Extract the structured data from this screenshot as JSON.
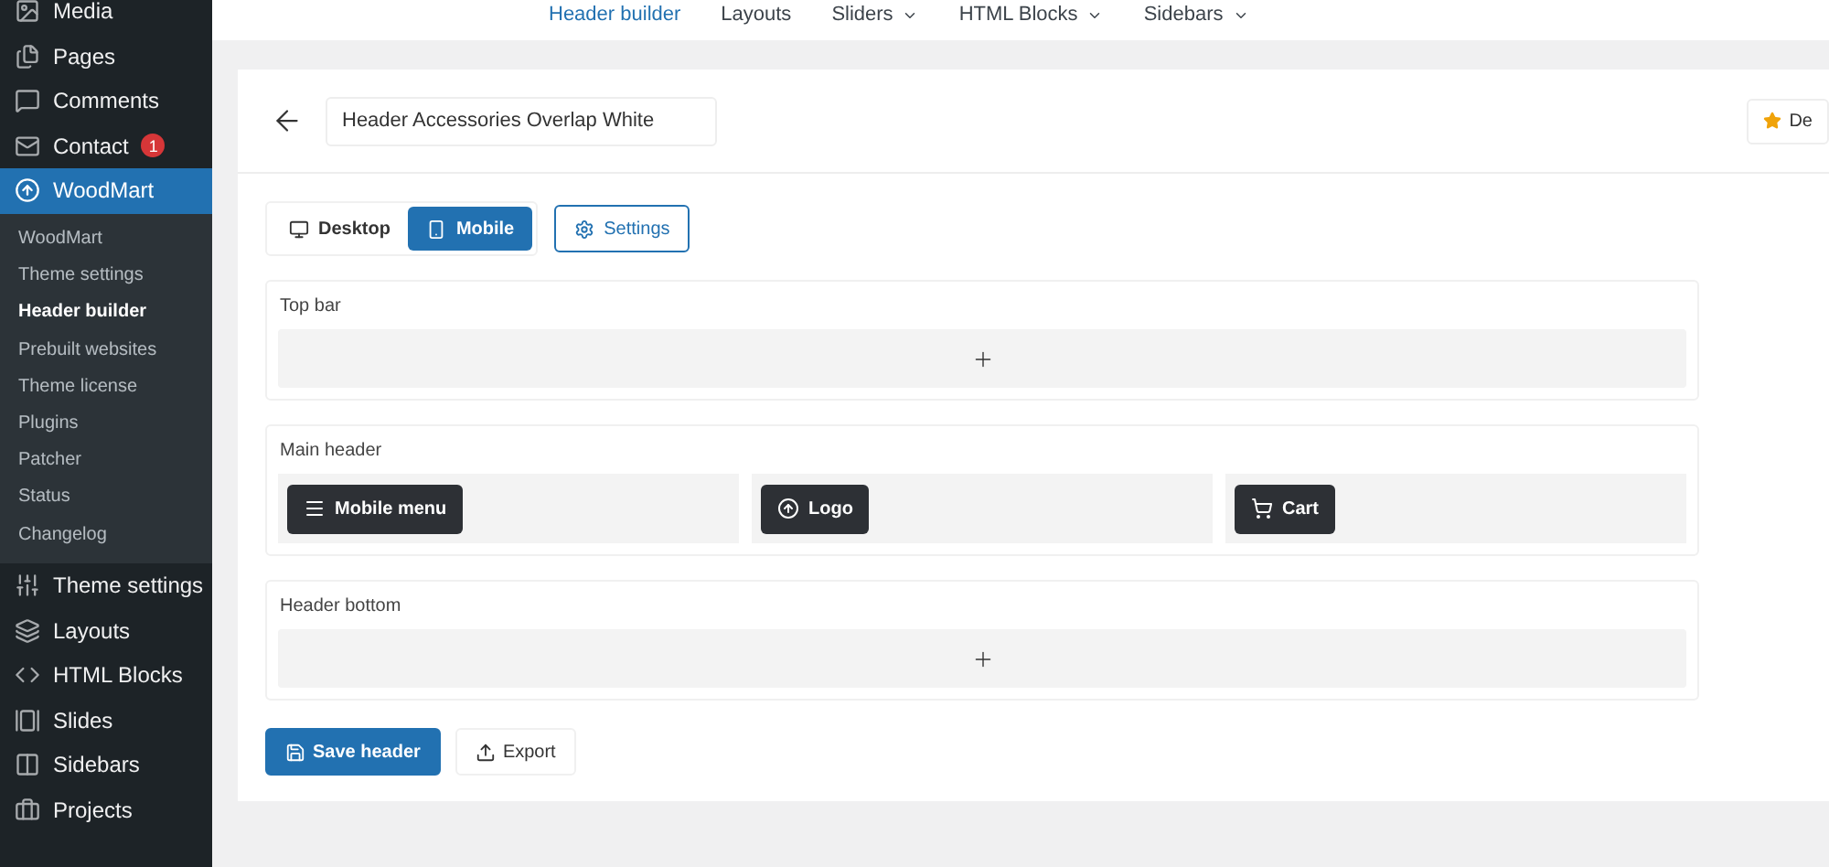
{
  "sidebar": {
    "items": [
      {
        "label": "Media",
        "selected": false
      },
      {
        "label": "Pages",
        "selected": false
      },
      {
        "label": "Comments",
        "selected": false
      },
      {
        "label": "Contact",
        "selected": false,
        "badge": "1"
      },
      {
        "label": "WoodMart",
        "selected": true,
        "children": [
          {
            "label": "WoodMart",
            "selected": false
          },
          {
            "label": "Theme settings",
            "selected": false
          },
          {
            "label": "Header builder",
            "selected": true
          },
          {
            "label": "Prebuilt websites",
            "selected": false
          },
          {
            "label": "Theme license",
            "selected": false
          },
          {
            "label": "Plugins",
            "selected": false
          },
          {
            "label": "Patcher",
            "selected": false
          },
          {
            "label": "Status",
            "selected": false
          },
          {
            "label": "Changelog",
            "selected": false
          }
        ]
      },
      {
        "label": "Theme settings",
        "selected": false
      },
      {
        "label": "Layouts",
        "selected": false
      },
      {
        "label": "HTML Blocks",
        "selected": false
      },
      {
        "label": "Slides",
        "selected": false
      },
      {
        "label": "Sidebars",
        "selected": false
      },
      {
        "label": "Projects",
        "selected": false
      }
    ]
  },
  "top_nav": [
    {
      "label": "Header builder",
      "selected": true,
      "dropdown": false
    },
    {
      "label": "Layouts",
      "selected": false,
      "dropdown": false
    },
    {
      "label": "Sliders",
      "selected": false,
      "dropdown": true
    },
    {
      "label": "HTML Blocks",
      "selected": false,
      "dropdown": true
    },
    {
      "label": "Sidebars",
      "selected": false,
      "dropdown": true
    }
  ],
  "header_name": {
    "value": "Header Accessories Overlap White"
  },
  "corner_button": {
    "label": "De"
  },
  "view_tabs": [
    {
      "label": "Desktop",
      "selected": false
    },
    {
      "label": "Mobile",
      "selected": true
    }
  ],
  "settings_button": {
    "label": "Settings"
  },
  "rows": [
    {
      "title": "Top bar",
      "columns": []
    },
    {
      "title": "Main header",
      "columns": [
        [
          {
            "label": "Mobile menu"
          }
        ],
        [
          {
            "label": "Logo"
          }
        ],
        [
          {
            "label": "Cart"
          }
        ]
      ]
    },
    {
      "title": "Header bottom",
      "columns": []
    }
  ],
  "actions": [
    {
      "label": "Save header",
      "kind": "primary"
    },
    {
      "label": "Export",
      "kind": "secondary"
    }
  ]
}
